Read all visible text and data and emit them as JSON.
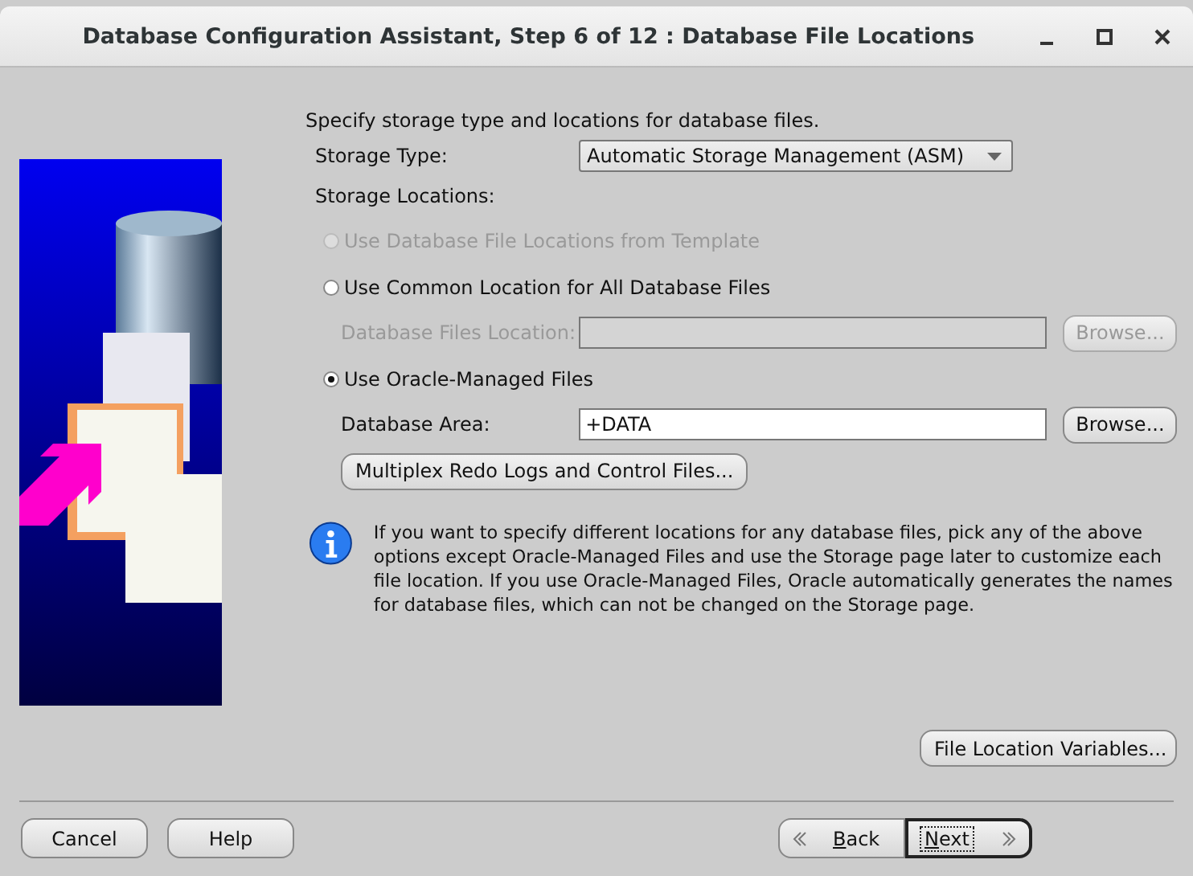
{
  "window": {
    "title": "Database Configuration Assistant, Step 6 of 12 : Database File Locations"
  },
  "intro": "Specify storage type and locations for database files.",
  "storage_type": {
    "label": "Storage Type:",
    "value": "Automatic Storage Management (ASM)"
  },
  "storage_locations_label": "Storage Locations:",
  "options": [
    {
      "kind": "radio",
      "label": "Use Database File Locations from Template",
      "selected": false,
      "disabled": true
    },
    {
      "kind": "radio",
      "label": "Use Common Location for All Database Files",
      "selected": false,
      "disabled": false
    },
    {
      "kind": "field",
      "label": "Database Files Location:",
      "disabled": true,
      "button": "Browse..."
    },
    {
      "kind": "radio",
      "label": "Use Oracle-Managed Files",
      "selected": true,
      "disabled": false
    },
    {
      "kind": "field",
      "label": "Database Area:",
      "value": "+DATA",
      "disabled": false,
      "button": "Browse..."
    },
    {
      "kind": "button",
      "label": "Multiplex Redo Logs and Control Files..."
    }
  ],
  "info": "If you want to specify different locations for any database files, pick any of the above options except Oracle-Managed Files and use the Storage page later to customize each file location. If you use Oracle-Managed Files, Oracle automatically generates the names for database files, which can not be changed on the Storage page.",
  "file_location_variables_button": "File Location Variables...",
  "footer": {
    "left": [
      "Cancel",
      "Help"
    ],
    "back": {
      "label": "Back",
      "mnemonic": true,
      "focused": false
    },
    "next": {
      "label": "Next",
      "mnemonic": true,
      "focused": true
    }
  }
}
